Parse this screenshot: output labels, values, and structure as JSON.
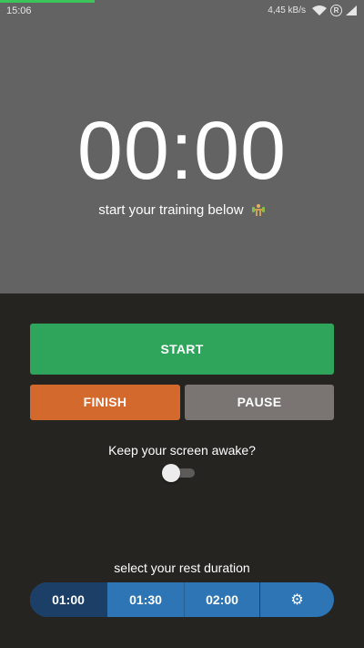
{
  "status_bar": {
    "time": "15:06",
    "net_speed": "4,45 kB/s",
    "circle_icon_letter": "R",
    "progress_fraction": 0.26
  },
  "timer": {
    "display": "00:00",
    "subtitle": "start your training below"
  },
  "buttons": {
    "start": "START",
    "finish": "FINISH",
    "pause": "PAUSE"
  },
  "screen_awake": {
    "label": "Keep your screen awake?",
    "enabled": false
  },
  "rest": {
    "label": "select your rest duration",
    "options": [
      "01:00",
      "01:30",
      "02:00"
    ],
    "selected": "01:00",
    "settings_icon": "gear-icon"
  },
  "colors": {
    "start": "#2ea55a",
    "finish": "#d4692d",
    "pause": "#7a7573",
    "segment": "#2e75b6",
    "segment_selected": "#1b3f66"
  }
}
